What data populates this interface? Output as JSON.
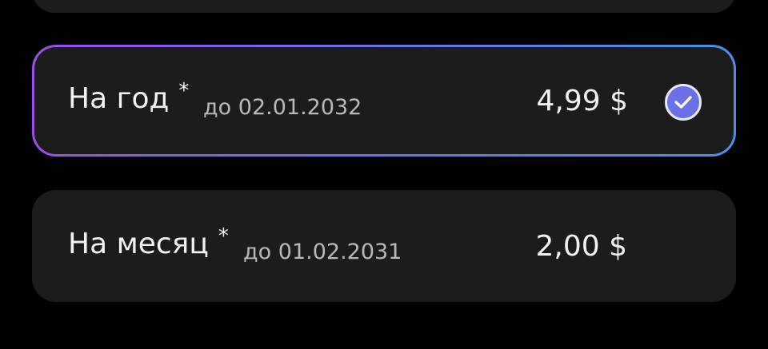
{
  "plans": [
    {
      "title": "На год",
      "star": "*",
      "until": "до 02.01.2032",
      "price": "4,99 $",
      "selected": true
    },
    {
      "title": "На месяц",
      "star": "*",
      "until": "до 01.02.2031",
      "price": "2,00 $",
      "selected": false
    }
  ],
  "icons": {
    "check": "check-circle-icon"
  },
  "colors": {
    "background": "#000000",
    "card": "#1c1c1c",
    "gradient_start": "#9b4fe8",
    "gradient_end": "#4a90e8",
    "check_fill": "#6b6fe8",
    "text_primary": "#f2f2f2",
    "text_secondary": "#b9b9b9"
  }
}
